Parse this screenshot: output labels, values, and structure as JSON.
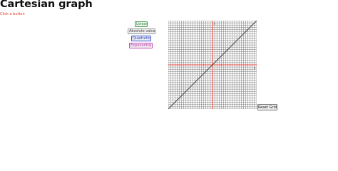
{
  "title": "Cartesian graph",
  "hint": "Click a button",
  "buttons": {
    "linear": "Linear",
    "absolute": "Absolute value",
    "quadratic": "Quadratic",
    "exponential": "Exponential",
    "reset": "Reset Grid"
  },
  "colors": {
    "grid": "#555555",
    "axis": "#e8463a",
    "plot": "#333333",
    "hint": "#e23a2e"
  },
  "graph": {
    "axis_x_label": "x",
    "axis_y_label": "y",
    "grid_min": -10,
    "grid_max": 10,
    "plotted_function": "linear",
    "plot_points": [
      [
        -10,
        -10
      ],
      [
        10,
        10
      ]
    ]
  }
}
